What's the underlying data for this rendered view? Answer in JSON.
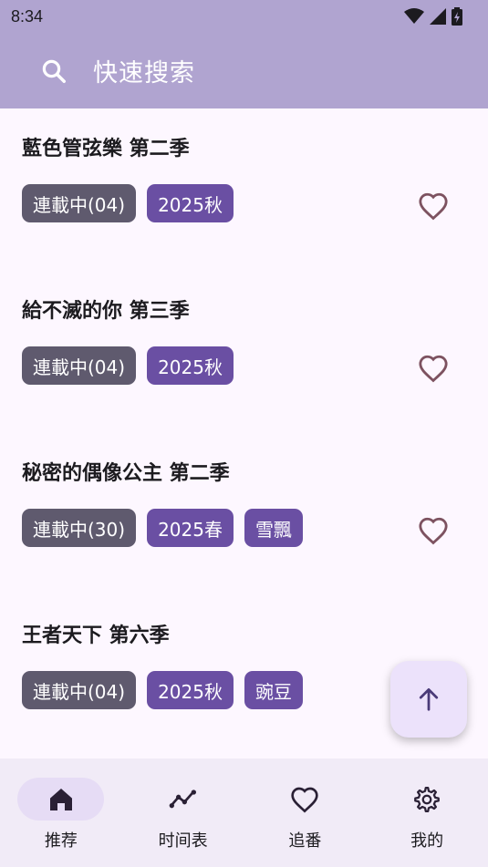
{
  "status_bar": {
    "time": "8:34"
  },
  "search": {
    "placeholder": "快速搜索"
  },
  "items": [
    {
      "title": "藍色管弦樂 第二季",
      "status": "連載中(04)",
      "season": "2025秋",
      "source": ""
    },
    {
      "title": "給不滅的你 第三季",
      "status": "連載中(04)",
      "season": "2025秋",
      "source": ""
    },
    {
      "title": "秘密的偶像公主 第二季",
      "status": "連載中(30)",
      "season": "2025春",
      "source": "雪飄"
    },
    {
      "title": "王者天下 第六季",
      "status": "連載中(04)",
      "season": "2025秋",
      "source": "豌豆"
    }
  ],
  "nav": {
    "items": [
      {
        "label": "推荐",
        "icon": "home-icon",
        "active": true
      },
      {
        "label": "时间表",
        "icon": "timeline-icon",
        "active": false
      },
      {
        "label": "追番",
        "icon": "heart-icon",
        "active": false
      },
      {
        "label": "我的",
        "icon": "gear-icon",
        "active": false
      }
    ]
  },
  "colors": {
    "app_bar": "#b0a4d0",
    "status_tag": "#5f5a6e",
    "season_tag": "#6a4fa3",
    "heart": "#7d5260",
    "fab_bg": "#ece2fb",
    "nav_bg": "#f1ebf7"
  }
}
